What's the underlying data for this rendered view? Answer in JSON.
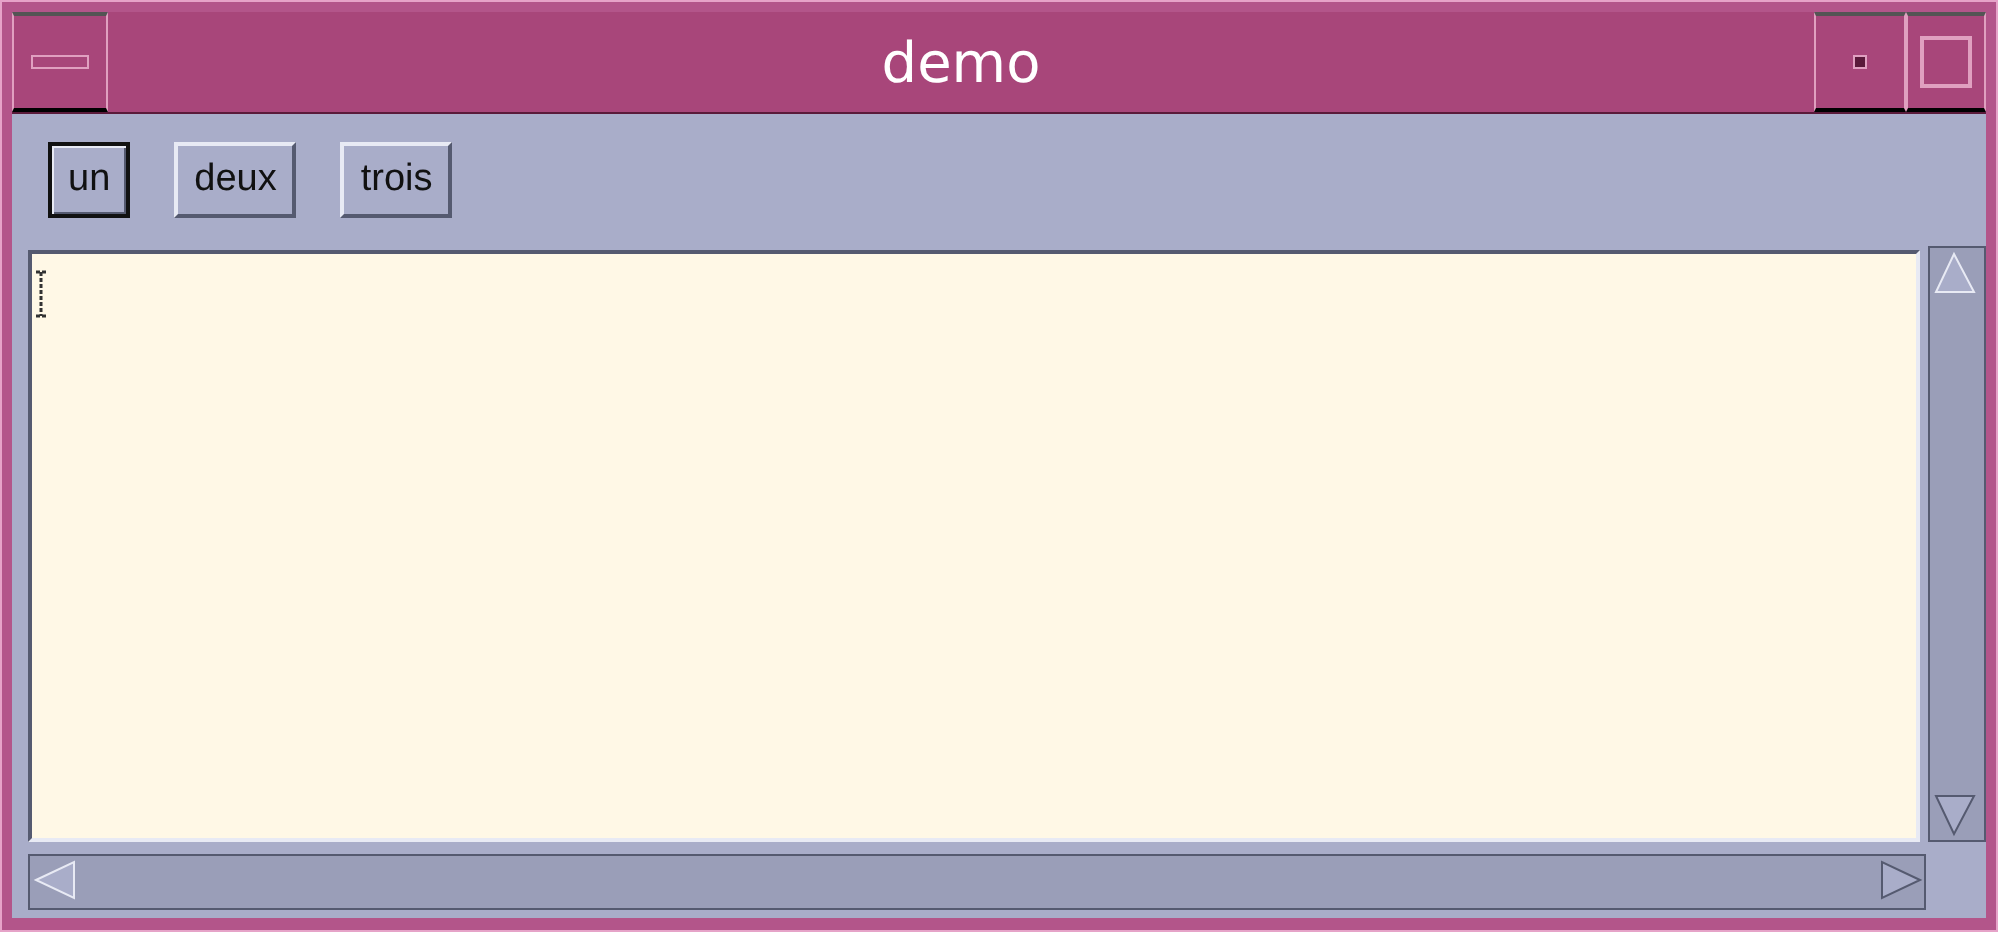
{
  "window": {
    "title": "demo"
  },
  "buttons": [
    {
      "label": "un",
      "focused": true
    },
    {
      "label": "deux",
      "focused": false
    },
    {
      "label": "trois",
      "focused": false
    }
  ],
  "text_area": {
    "focused": true
  }
}
